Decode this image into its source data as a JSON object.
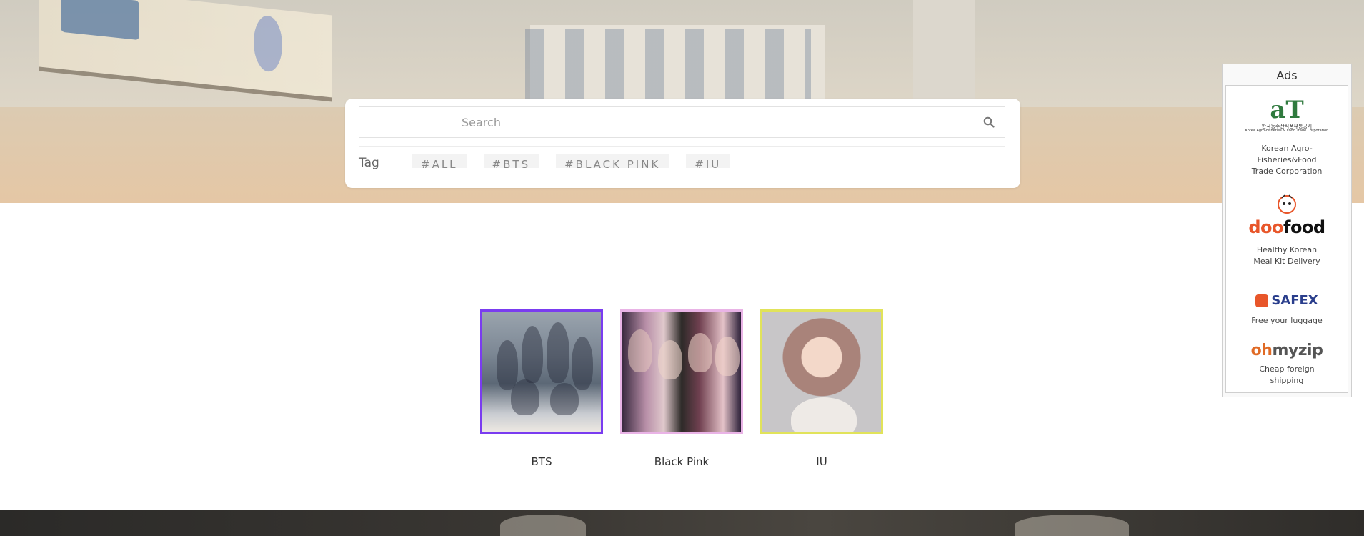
{
  "search": {
    "placeholder": "Search",
    "tag_label": "Tag",
    "tags": [
      "#ALL",
      "#BTS",
      "#BLACK PINK",
      "#IU"
    ]
  },
  "artists": [
    {
      "name": "BTS",
      "border_color": "#7a3cf0"
    },
    {
      "name": "Black Pink",
      "border_color": "#e9b3e6"
    },
    {
      "name": "IU",
      "border_color": "#e1e35a"
    }
  ],
  "ads": {
    "title": "Ads",
    "items": [
      {
        "logo_main": "aT",
        "logo_sub": "한국농수산식품유통공사",
        "logo_sub2": "Korea Agro-Fisheries & Food Trade Corporation",
        "desc": "Korean Agro-Fisheries&Food Trade Corporation"
      },
      {
        "logo": "doofood",
        "desc": "Healthy Korean Meal Kit Delivery"
      },
      {
        "logo": "safex",
        "desc": "Free your luggage"
      },
      {
        "logo": "ohmyzip",
        "desc": "Cheap foreign shipping"
      }
    ]
  },
  "colors": {
    "accent_bts": "#7a3cf0",
    "accent_blackpink": "#e9b3e6",
    "accent_iu": "#e1e35a"
  }
}
